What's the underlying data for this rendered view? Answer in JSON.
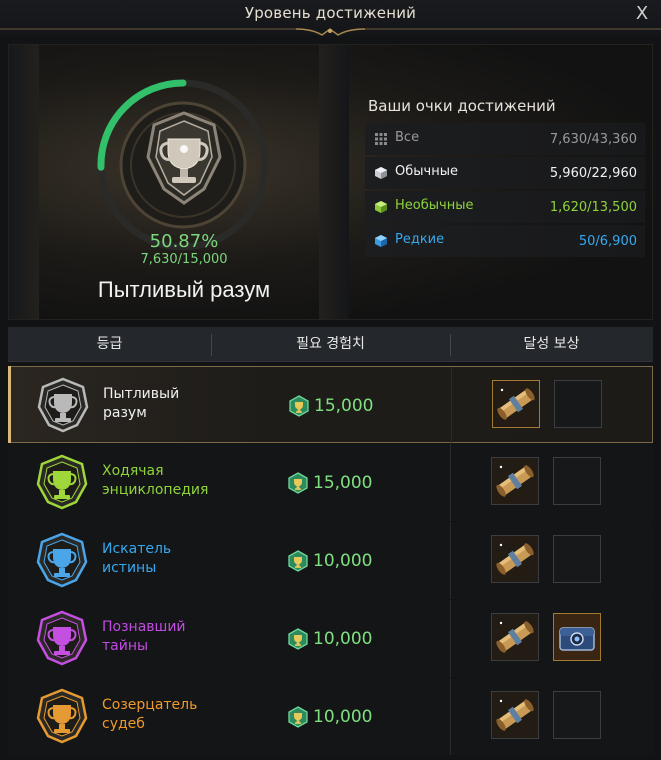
{
  "window": {
    "title": "Уровень достижений",
    "close_label": "X"
  },
  "progress": {
    "percent_text": "50.87%",
    "points_text": "7,630/15,000",
    "fraction": 0.5087,
    "current_rank": "Пытливый разум"
  },
  "scores": {
    "heading": "Ваши очки достижений",
    "items": [
      {
        "label": "Все",
        "value": "7,630/43,360",
        "icon": "grid-icon",
        "color": "#9a9a9a"
      },
      {
        "label": "Обычные",
        "value": "5,960/22,960",
        "icon": "white-cube-icon",
        "color": "#f2f2f2"
      },
      {
        "label": "Необычные",
        "value": "1,620/13,500",
        "icon": "green-cube-icon",
        "color": "#8fd43a"
      },
      {
        "label": "Редкие",
        "value": "50/6,900",
        "icon": "blue-cube-icon",
        "color": "#38a8ee"
      }
    ]
  },
  "table": {
    "headers": [
      "등급",
      "필요 경험치",
      "달성 보상"
    ],
    "rows": [
      {
        "rank": "Пытливый\nразум",
        "color": "#f0f0f0",
        "exp": "15,000",
        "badge": "silver-trophy-icon",
        "badge_color": "#b9b9b9",
        "rewards": [
          "scroll-icon",
          "empty-slot"
        ],
        "active": true
      },
      {
        "rank": "Ходячая\nэнциклопедия",
        "color": "#8fd43a",
        "exp": "15,000",
        "badge": "green-trophy-icon",
        "badge_color": "#9fd63a",
        "rewards": [
          "scroll-icon",
          "empty-slot"
        ],
        "active": false
      },
      {
        "rank": "Искатель\nистины",
        "color": "#38a8ee",
        "exp": "10,000",
        "badge": "blue-trophy-icon",
        "badge_color": "#4aa6e8",
        "rewards": [
          "scroll-icon",
          "empty-slot"
        ],
        "active": false
      },
      {
        "rank": "Познавший\nтайны",
        "color": "#c24be0",
        "exp": "10,000",
        "badge": "purple-trophy-icon",
        "badge_color": "#c44fe0",
        "rewards": [
          "scroll-icon",
          "chest-icon"
        ],
        "active": false
      },
      {
        "rank": "Созерцатель\nсудеб",
        "color": "#f09a2a",
        "exp": "10,000",
        "badge": "orange-trophy-icon",
        "badge_color": "#e59a33",
        "rewards": [
          "scroll-icon",
          "empty-slot"
        ],
        "active": false
      }
    ]
  }
}
